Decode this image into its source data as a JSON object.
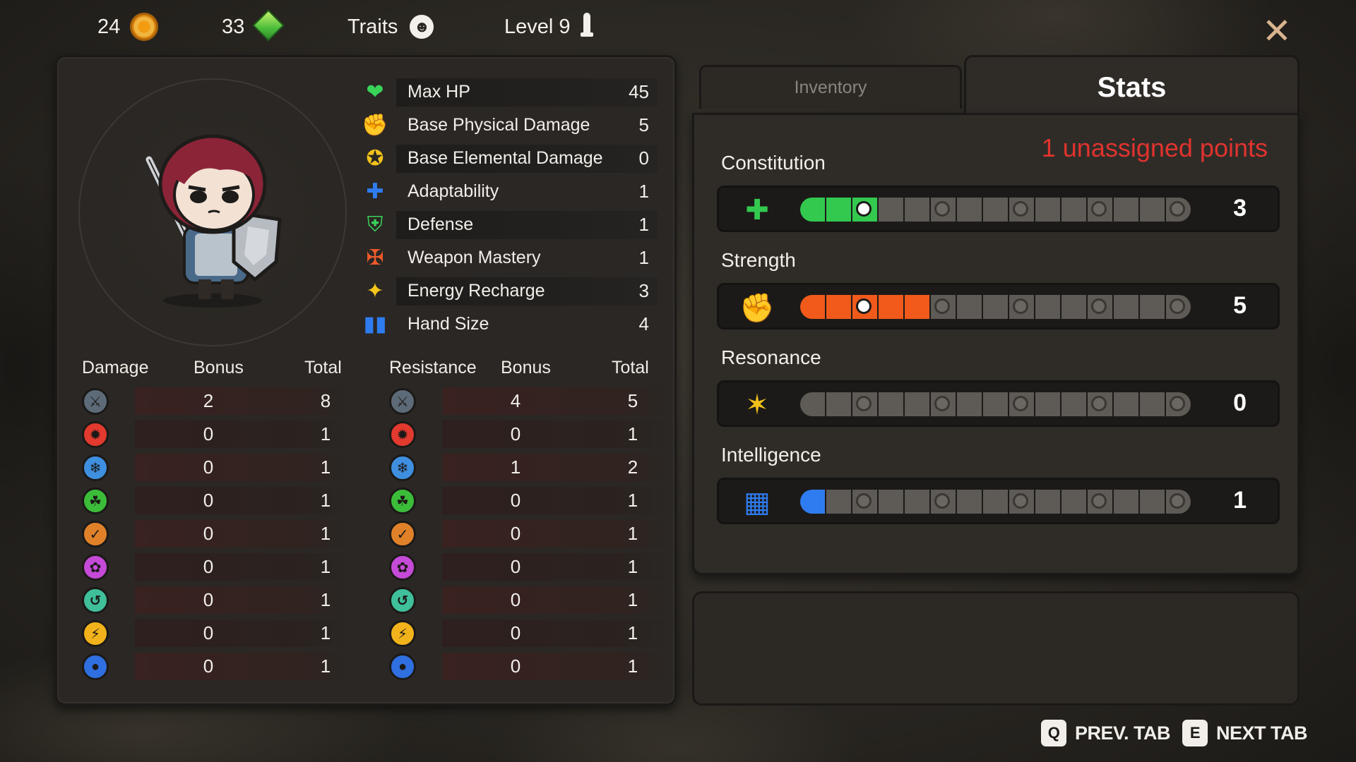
{
  "topbar": {
    "gold": "24",
    "gems": "33",
    "traits_label": "Traits",
    "level_label": "Level 9"
  },
  "character_stats": [
    {
      "label": "Max HP",
      "value": "45",
      "icon": "heart-icon",
      "color": "#3ad35a"
    },
    {
      "label": "Base Physical Damage",
      "value": "5",
      "icon": "fist-icon",
      "color": "#f07a2a"
    },
    {
      "label": "Base Elemental Damage",
      "value": "0",
      "icon": "burst-icon",
      "color": "#f2c21b"
    },
    {
      "label": "Adaptability",
      "value": "1",
      "icon": "puzzle-icon",
      "color": "#2f7cf0"
    },
    {
      "label": "Defense",
      "value": "1",
      "icon": "shield-icon",
      "color": "#3ad35a"
    },
    {
      "label": "Weapon Mastery",
      "value": "1",
      "icon": "weapon-icon",
      "color": "#f05a2a"
    },
    {
      "label": "Energy Recharge",
      "value": "3",
      "icon": "star-icon",
      "color": "#f7c61b"
    },
    {
      "label": "Hand Size",
      "value": "4",
      "icon": "cards-icon",
      "color": "#2f7cf0"
    }
  ],
  "damage_table": {
    "headers": [
      "Damage",
      "Bonus",
      "Total"
    ],
    "rows": [
      {
        "icon": "physical-icon",
        "bonus": "2",
        "total": "8"
      },
      {
        "icon": "fire-icon",
        "bonus": "0",
        "total": "1"
      },
      {
        "icon": "ice-icon",
        "bonus": "0",
        "total": "1"
      },
      {
        "icon": "nature-icon",
        "bonus": "0",
        "total": "1"
      },
      {
        "icon": "earth-icon",
        "bonus": "0",
        "total": "1"
      },
      {
        "icon": "arcane-icon",
        "bonus": "0",
        "total": "1"
      },
      {
        "icon": "wind-icon",
        "bonus": "0",
        "total": "1"
      },
      {
        "icon": "lightning-icon",
        "bonus": "0",
        "total": "1"
      },
      {
        "icon": "water-icon",
        "bonus": "0",
        "total": "1"
      }
    ]
  },
  "resistance_table": {
    "headers": [
      "Resistance",
      "Bonus",
      "Total"
    ],
    "rows": [
      {
        "icon": "physical-icon",
        "bonus": "4",
        "total": "5"
      },
      {
        "icon": "fire-icon",
        "bonus": "0",
        "total": "1"
      },
      {
        "icon": "ice-icon",
        "bonus": "1",
        "total": "2"
      },
      {
        "icon": "nature-icon",
        "bonus": "0",
        "total": "1"
      },
      {
        "icon": "earth-icon",
        "bonus": "0",
        "total": "1"
      },
      {
        "icon": "arcane-icon",
        "bonus": "0",
        "total": "1"
      },
      {
        "icon": "wind-icon",
        "bonus": "0",
        "total": "1"
      },
      {
        "icon": "lightning-icon",
        "bonus": "0",
        "total": "1"
      },
      {
        "icon": "water-icon",
        "bonus": "0",
        "total": "1"
      }
    ]
  },
  "element_colors": {
    "physical-icon": "#5d6a78",
    "fire-icon": "#e23a2e",
    "ice-icon": "#3f8fe0",
    "nature-icon": "#3bbd3a",
    "earth-icon": "#e0812a",
    "arcane-icon": "#c54ad8",
    "wind-icon": "#3fbf9a",
    "lightning-icon": "#f2b21b",
    "water-icon": "#2f6fe0"
  },
  "tabs": {
    "inventory": "Inventory",
    "stats": "Stats"
  },
  "stats_panel": {
    "unassigned": "1 unassigned points",
    "attributes": [
      {
        "name": "Constitution",
        "value": "3",
        "color": "#33c94f",
        "icon": "cross-shield-icon"
      },
      {
        "name": "Strength",
        "value": "5",
        "color": "#f15a1a",
        "icon": "raised-fist-icon"
      },
      {
        "name": "Resonance",
        "value": "0",
        "color": "#f2c21b",
        "icon": "spiral-icon"
      },
      {
        "name": "Intelligence",
        "value": "1",
        "color": "#2f7cf0",
        "icon": "tome-icon"
      }
    ],
    "max_points": 15
  },
  "hints": {
    "prev_key": "Q",
    "prev_label": "PREV. TAB",
    "next_key": "E",
    "next_label": "NEXT TAB"
  }
}
